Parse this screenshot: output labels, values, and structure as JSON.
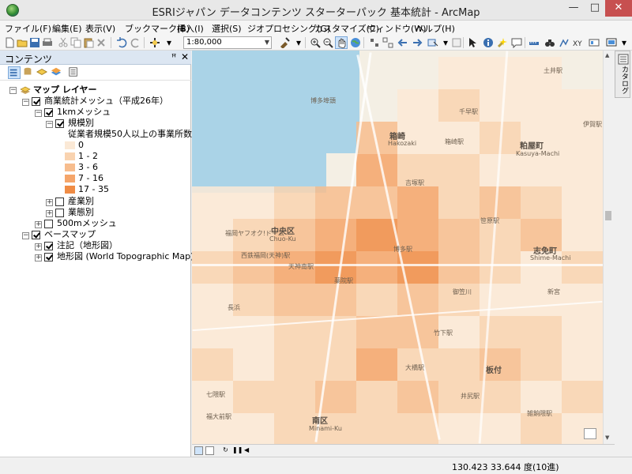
{
  "window": {
    "title": "ESRIジャパン データコンテンツ スターターパック 基本統計 - ArcMap",
    "minimize": "—",
    "maximize": "□",
    "close": "✕"
  },
  "menu": [
    "ファイル(F)",
    "編集(E)",
    "表示(V)",
    "ブックマーク(B)",
    "挿入(I)",
    "選択(S)",
    "ジオプロセシング(G)",
    "カスタマイズ(C)",
    "ウィンドウ(W)",
    "ヘルプ(H)"
  ],
  "toolbar": {
    "scale": "1:80,000"
  },
  "toc": {
    "title": "コンテンツ",
    "pin": "ꟸ",
    "close": "✕",
    "tree": {
      "map_layers": "マップ レイヤー",
      "commerce_mesh": "商業統計メッシュ（平成26年）",
      "mesh_1km": "1kmメッシュ",
      "by_scale": "規模別",
      "legend_title": "従業者規模50人以上の事業所数",
      "legend": [
        {
          "label": "0",
          "color": "#fbe9d6"
        },
        {
          "label": "1 - 2",
          "color": "#f9d3b0"
        },
        {
          "label": "3 - 6",
          "color": "#f7bd8e"
        },
        {
          "label": "7 - 16",
          "color": "#f5a56a"
        },
        {
          "label": "17 - 35",
          "color": "#f08c45"
        }
      ],
      "by_industry": "産業別",
      "by_type": "業態別",
      "mesh_500m": "500mメッシュ",
      "basemap": "ベースマップ",
      "annotation": "注記（地形図）",
      "topo": "地形図 (World Topographic Map)"
    }
  },
  "map": {
    "labels": {
      "hakata_port": "博多埠頭",
      "hakozaki": "箱崎",
      "hakozaki_roman": "Hakozaki",
      "hakozaki_eki": "箱崎駅",
      "yoshizuka": "吉塚駅",
      "kashii_wmb": "千早駅",
      "tonoura": "土井駅",
      "iga": "伊賀駅",
      "kasuya": "粕屋町",
      "kasuya_roman": "Kasuya-Machi",
      "chuo": "中央区",
      "chuo_roman": "Chuo-Ku",
      "tenjin": "西鉄福岡(天神)駅",
      "hakata": "博多駅",
      "shime": "志免町",
      "shime_roman": "Shime-Machi",
      "yakuin": "薬院駅",
      "takeshita": "竹下駅",
      "ohashi": "大橋駅",
      "itazuke": "板付",
      "minami": "南区",
      "minami_roman": "Minami-Ku",
      "nanakuma": "七隈駅",
      "yamamoto": "福大前駅",
      "ijiri": "井尻駅",
      "zasshonokuma": "雑餉隈駅",
      "fukuoka_dome": "福岡ヤフオク!ドーム",
      "tenjinminami": "天神南駅",
      "nagahama": "長浜",
      "shin_oura": "新宮",
      "sasaharu": "笹原駅",
      "mikasa": "御笠川"
    }
  },
  "side_tab": "カタログ",
  "status": {
    "coords": "130.423  33.644 度(10進)"
  },
  "colors": {
    "accent": "#dce6f2",
    "sea": "#aad3e7",
    "land": "#f4efe4",
    "close": "#c75050"
  }
}
